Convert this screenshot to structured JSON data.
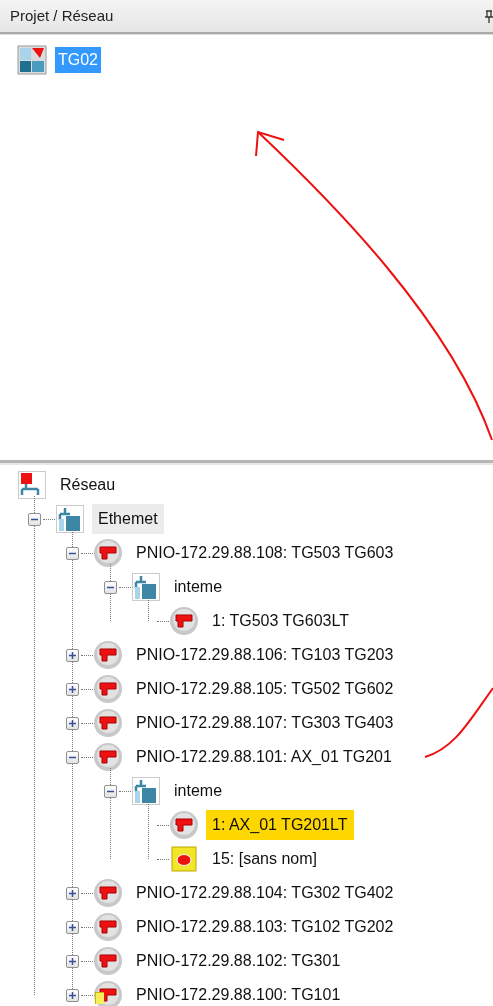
{
  "panel": {
    "title": "Projet / Réseau"
  },
  "project_tree": [
    {
      "label": "TG02",
      "kind": "project",
      "selected": true
    }
  ],
  "network_tree": [
    {
      "label": "Réseau",
      "kind": "network",
      "selected": false,
      "highlighted": false,
      "children": [
        {
          "label": "Ethemet",
          "kind": "bus",
          "expanded": true,
          "selected": true,
          "highlighted": false,
          "children": [
            {
              "label": "PNIO-172.29.88.108: TG503 TG603",
              "kind": "device",
              "expanded": true,
              "selected": false,
              "highlighted": false,
              "children": [
                {
                  "label": "inteme",
                  "kind": "bus",
                  "expanded": true,
                  "selected": false,
                  "highlighted": false,
                  "children": [
                    {
                      "label": "1: TG503 TG603LT",
                      "kind": "device",
                      "selected": false,
                      "highlighted": false
                    }
                  ]
                }
              ]
            },
            {
              "label": "PNIO-172.29.88.106: TG103 TG203",
              "kind": "device",
              "expanded": false,
              "selected": false,
              "highlighted": false
            },
            {
              "label": "PNIO-172.29.88.105: TG502 TG602",
              "kind": "device",
              "expanded": false,
              "selected": false,
              "highlighted": false
            },
            {
              "label": "PNIO-172.29.88.107: TG303 TG403",
              "kind": "device",
              "expanded": false,
              "selected": false,
              "highlighted": false
            },
            {
              "label": "PNIO-172.29.88.101: AX_01 TG201",
              "kind": "device",
              "expanded": true,
              "selected": false,
              "highlighted": false,
              "children": [
                {
                  "label": "inteme",
                  "kind": "bus",
                  "expanded": true,
                  "selected": false,
                  "highlighted": false,
                  "children": [
                    {
                      "label": "1: AX_01 TG201LT",
                      "kind": "device",
                      "selected": false,
                      "highlighted": true
                    },
                    {
                      "label": "15: [sans nom]",
                      "kind": "module",
                      "selected": false,
                      "highlighted": false
                    }
                  ]
                }
              ]
            },
            {
              "label": "PNIO-172.29.88.104: TG302 TG402",
              "kind": "device",
              "expanded": false,
              "selected": false,
              "highlighted": false
            },
            {
              "label": "PNIO-172.29.88.103: TG102 TG202",
              "kind": "device",
              "expanded": false,
              "selected": false,
              "highlighted": false
            },
            {
              "label": "PNIO-172.29.88.102: TG301",
              "kind": "device",
              "expanded": false,
              "selected": false,
              "highlighted": false
            },
            {
              "label": "PNIO-172.29.88.100: TG101",
              "kind": "device",
              "expanded": false,
              "selected": false,
              "highlighted": false,
              "warning": true
            }
          ]
        }
      ]
    }
  ]
}
